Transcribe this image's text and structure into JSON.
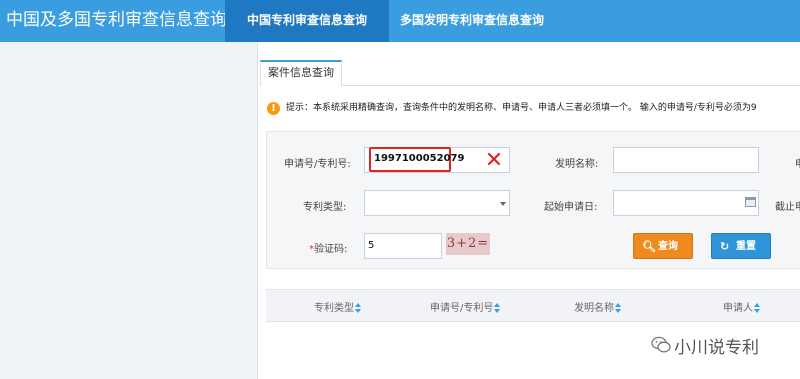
{
  "header": {
    "app_title": "中国及多国专利审查信息查询",
    "tabs": [
      {
        "label": "中国专利审查信息查询",
        "active": true
      },
      {
        "label": "多国发明专利审查信息查询",
        "active": false
      }
    ],
    "bg_color": "#3a9de0",
    "active_tab_color": "#1e78c2"
  },
  "panel": {
    "tab_label": "案件信息查询",
    "notice_icon": "info-exclamation-icon",
    "notice_text": "提示：本系统采用精确查询，查询条件中的发明名称、申请号、申请人三者必须填一个。 输入的申请号/专利号必须为9"
  },
  "form": {
    "app_no": {
      "label": "申请号/专利号:",
      "value": "1997100052079"
    },
    "invention_name": {
      "label": "发明名称:",
      "value": ""
    },
    "right_cut_label_1": "申",
    "patent_type": {
      "label": "专利类型:",
      "value": ""
    },
    "start_date": {
      "label": "起始申请日:",
      "value": ""
    },
    "end_date_label": "截止申",
    "captcha": {
      "label": "验证码:",
      "required_mark": "*",
      "value": "5",
      "image_text": "3+2="
    },
    "query_button": "查询",
    "reset_button": "重置"
  },
  "table": {
    "columns": [
      "专利类型",
      "申请号/专利号",
      "发明名称",
      "申请人"
    ]
  },
  "watermark": {
    "text": "小川说专利",
    "icon": "wechat-icon"
  }
}
